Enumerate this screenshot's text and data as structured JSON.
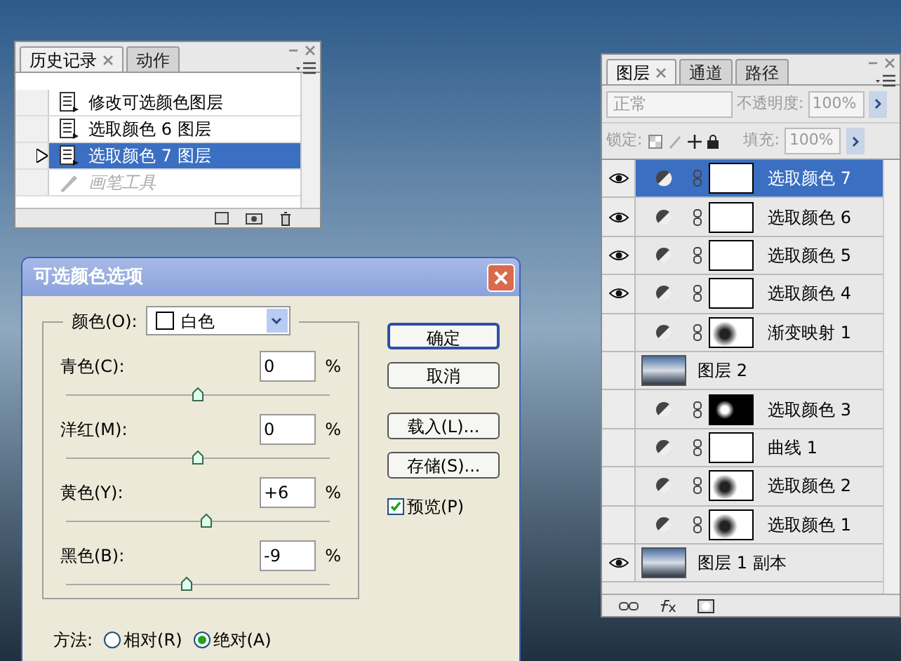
{
  "history_panel": {
    "tabs": [
      {
        "label": "历史记录",
        "selected": true
      },
      {
        "label": "动作",
        "selected": false
      }
    ],
    "steps": [
      {
        "label": "修改可选颜色图层",
        "kind": "adjustment",
        "selected": false,
        "disabled": false
      },
      {
        "label": "选取颜色 6 图层",
        "kind": "adjustment",
        "selected": false,
        "disabled": false
      },
      {
        "label": "选取颜色 7 图层",
        "kind": "adjustment",
        "selected": true,
        "disabled": false
      },
      {
        "label": "画笔工具",
        "kind": "brush",
        "selected": false,
        "disabled": true
      }
    ]
  },
  "dialog": {
    "title": "可选颜色选项",
    "color_label": "颜色(O):",
    "color_value": "白色",
    "sliders": [
      {
        "label": "青色(C):",
        "value": "0",
        "unit": "%",
        "level": 0.5
      },
      {
        "label": "洋红(M):",
        "value": "0",
        "unit": "%",
        "level": 0.5
      },
      {
        "label": "黄色(Y):",
        "value": "+6",
        "unit": "%",
        "level": 0.53
      },
      {
        "label": "黑色(B):",
        "value": "-9",
        "unit": "%",
        "level": 0.46
      }
    ],
    "buttons": [
      {
        "label": "确定",
        "default": true
      },
      {
        "label": "取消",
        "default": false
      },
      {
        "label": "载入(L)...",
        "default": false
      },
      {
        "label": "存储(S)...",
        "default": false
      }
    ],
    "preview": {
      "label": "预览(P)",
      "checked": true
    },
    "method": {
      "label": "方法:",
      "options": [
        {
          "label": "相对(R)",
          "selected": false
        },
        {
          "label": "绝对(A)",
          "selected": true
        }
      ]
    }
  },
  "layers_panel": {
    "tabs": [
      {
        "label": "图层",
        "selected": true
      },
      {
        "label": "通道",
        "selected": false
      },
      {
        "label": "路径",
        "selected": false
      }
    ],
    "blend_mode": "正常",
    "opacity_label": "不透明度:",
    "opacity": "100%",
    "lock_label": "锁定:",
    "fill_label": "填充:",
    "fill": "100%",
    "layers": [
      {
        "name": "选取颜色 7",
        "kind": "blank",
        "visible": true,
        "selected": true
      },
      {
        "name": "选取颜色 6",
        "kind": "blank",
        "visible": true,
        "selected": false
      },
      {
        "name": "选取颜色 5",
        "kind": "blank",
        "visible": true,
        "selected": false
      },
      {
        "name": "选取颜色 4",
        "kind": "blank",
        "visible": true,
        "selected": false
      },
      {
        "name": "渐变映射 1",
        "kind": "figure",
        "visible": false,
        "selected": false
      },
      {
        "name": "图层 2",
        "kind": "pixel",
        "visible": false,
        "selected": false
      },
      {
        "name": "选取颜色 3",
        "kind": "dark",
        "visible": false,
        "selected": false
      },
      {
        "name": "曲线 1",
        "kind": "blank",
        "visible": false,
        "selected": false
      },
      {
        "name": "选取颜色 2",
        "kind": "figure",
        "visible": false,
        "selected": false
      },
      {
        "name": "选取颜色 1",
        "kind": "figure",
        "visible": false,
        "selected": false
      },
      {
        "name": "图层 1 副本",
        "kind": "pixel",
        "visible": true,
        "selected": false
      }
    ]
  }
}
